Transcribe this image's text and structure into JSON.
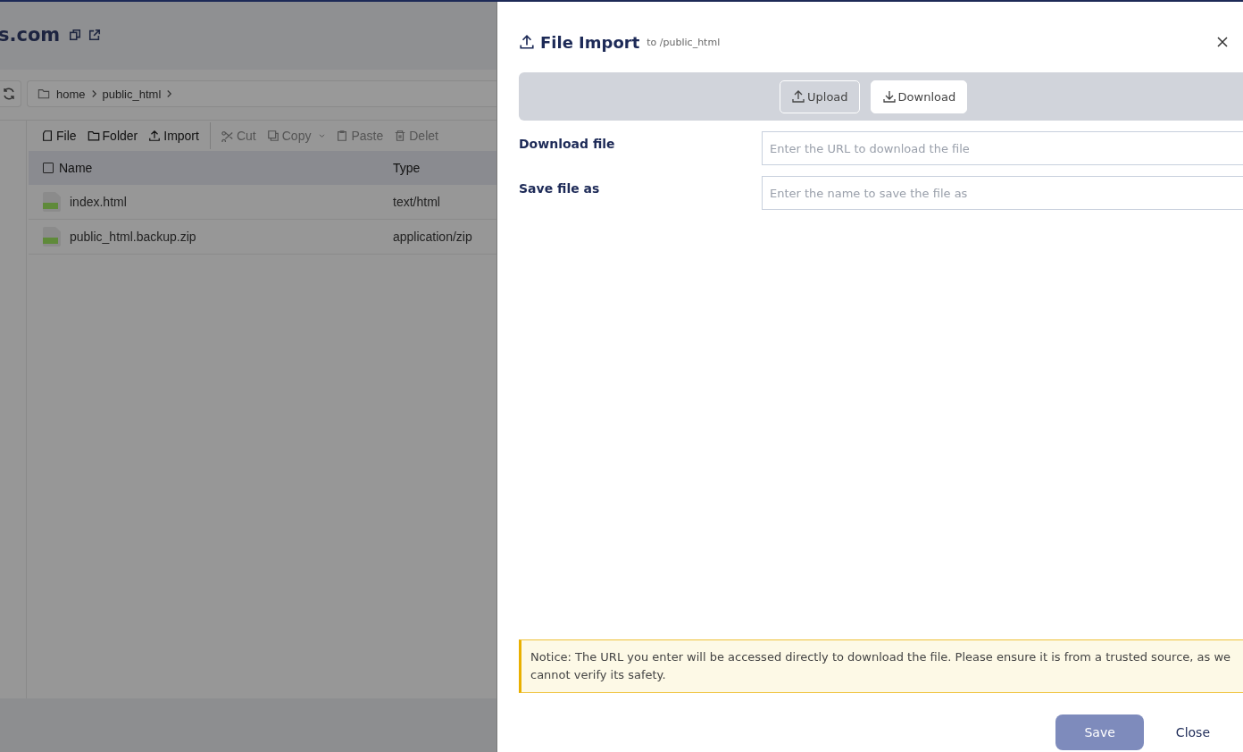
{
  "page": {
    "site_title": "s.com",
    "breadcrumb": [
      "home",
      "public_html"
    ],
    "toolbar": [
      {
        "label": "File",
        "disabled": false
      },
      {
        "label": "Folder",
        "disabled": false
      },
      {
        "label": "Import",
        "disabled": false
      },
      {
        "label": "Cut",
        "disabled": true
      },
      {
        "label": "Copy",
        "disabled": true
      },
      {
        "label": "Paste",
        "disabled": true
      },
      {
        "label": "Delet",
        "disabled": true
      }
    ],
    "table": {
      "select_all_checked": false,
      "columns": [
        "Name",
        "Type"
      ],
      "rows": [
        {
          "name": "index.html",
          "type": "text/html"
        },
        {
          "name": "public_html.backup.zip",
          "type": "application/zip"
        }
      ]
    }
  },
  "drawer": {
    "title": "File Import",
    "subtitle": "to /public_html",
    "tabs": [
      {
        "label": "Upload",
        "selected": false
      },
      {
        "label": "Download",
        "selected": true
      }
    ],
    "fields": [
      {
        "label": "Download file",
        "placeholder": "Enter the URL to download the file"
      },
      {
        "label": "Save file as",
        "placeholder": "Enter the name to save the file as"
      }
    ],
    "notice": "Notice: The URL you enter will be accessed directly to download the file. Please ensure it is from a trusted source, as we cannot verify its safety.",
    "save_button": {
      "label": "Save",
      "disabled": true
    },
    "close_button": {
      "label": "Close"
    }
  }
}
